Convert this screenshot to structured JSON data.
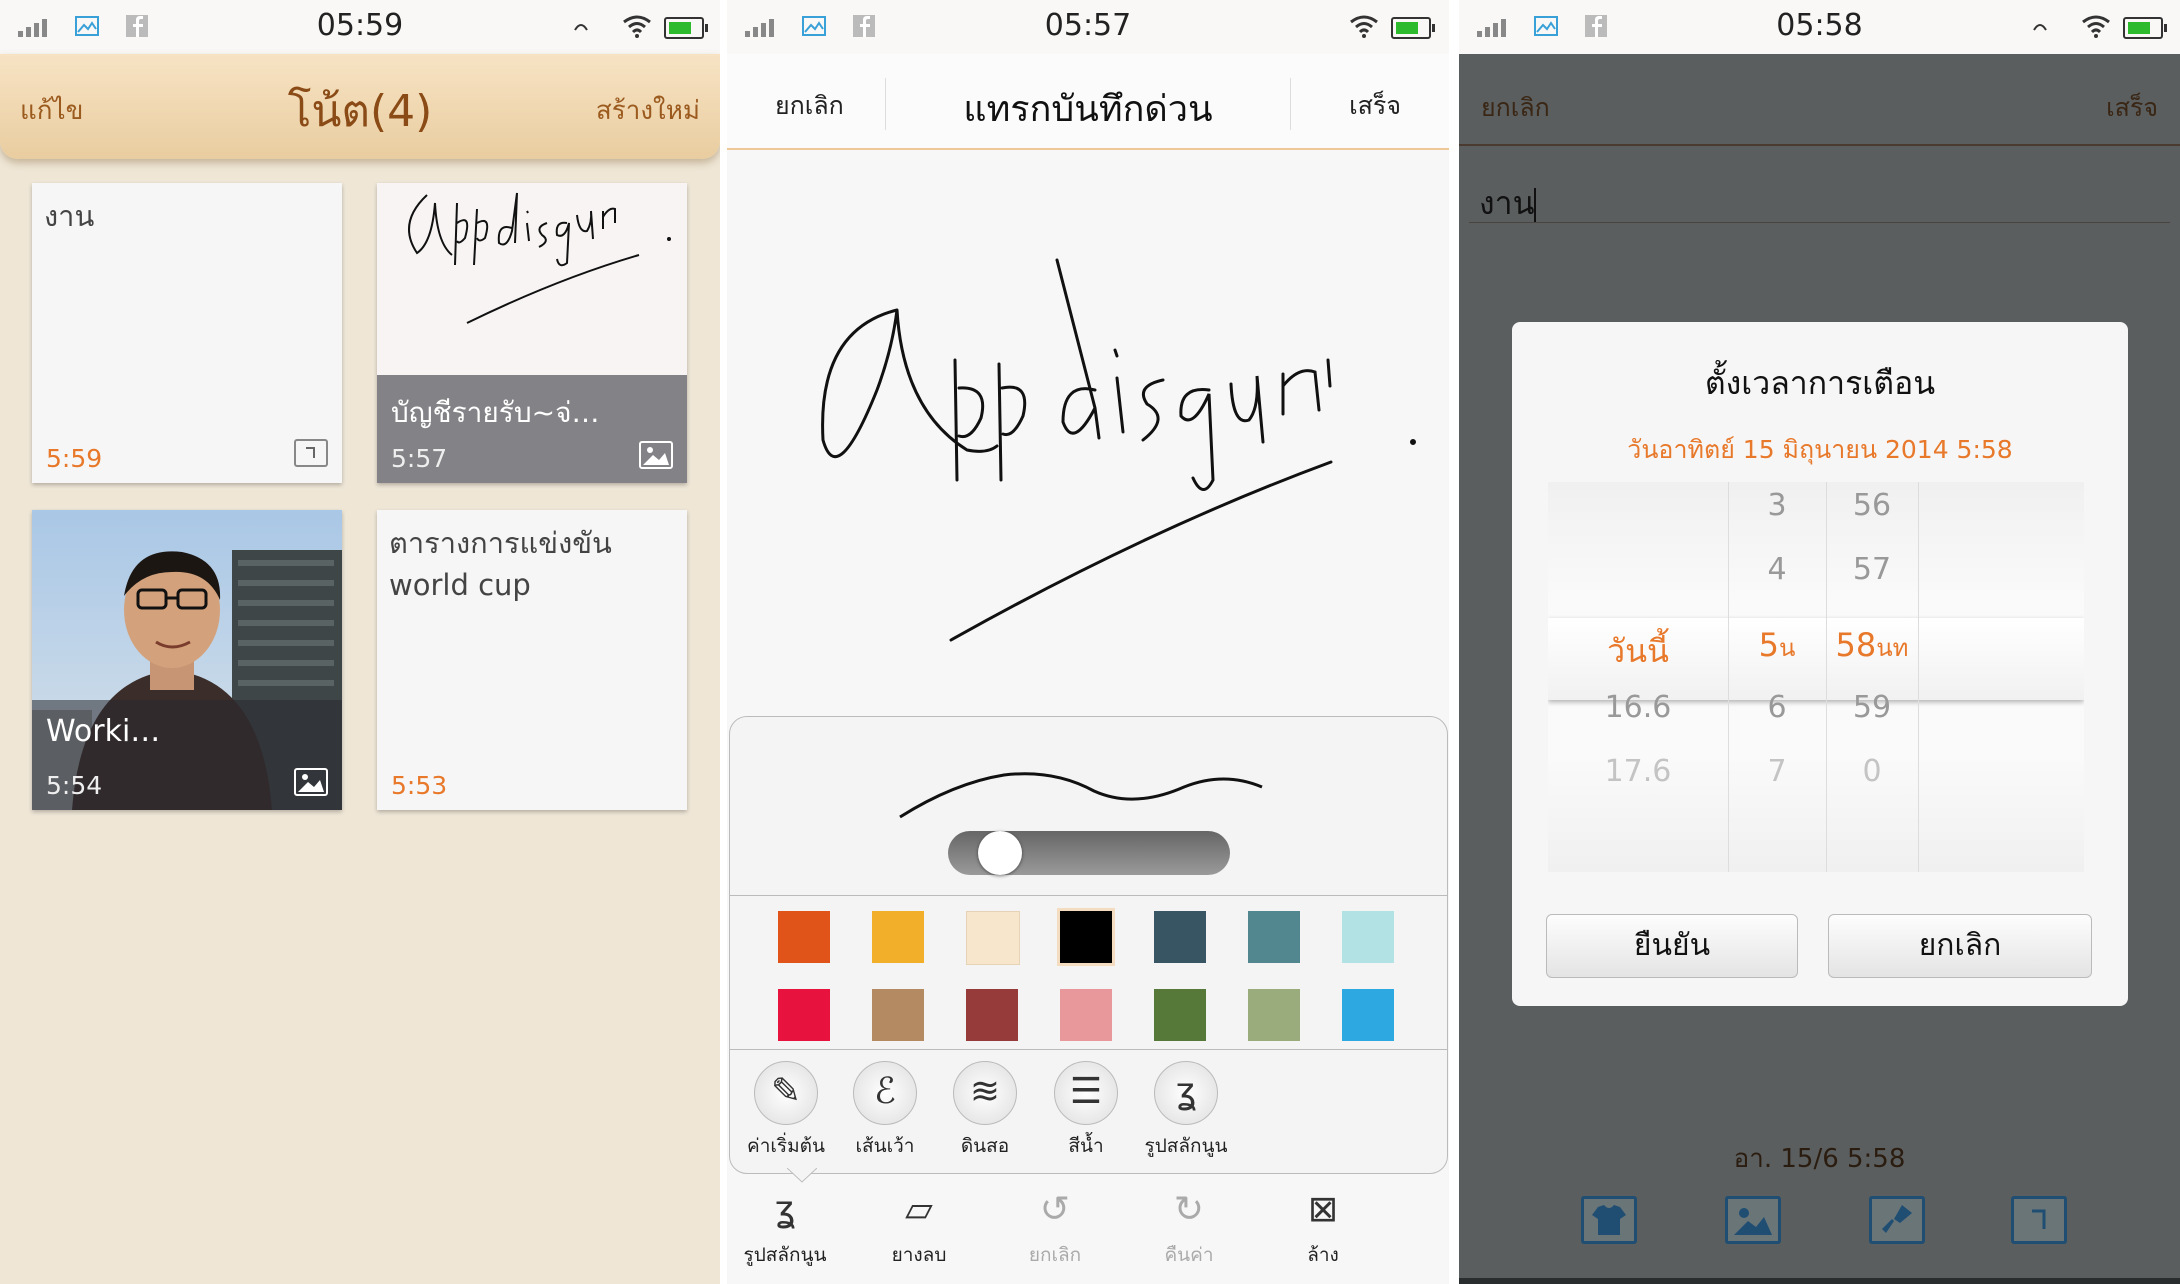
{
  "status_bars": [
    {
      "time": "05:59"
    },
    {
      "time": "05:57"
    },
    {
      "time": "05:58"
    }
  ],
  "notes_list": {
    "edit_label": "แก้ไข",
    "title": "โน้ต(4)",
    "new_label": "สร้างใหม่",
    "cards": [
      {
        "text": "งาน",
        "time": "5:59",
        "icon": "alarm-icon"
      },
      {
        "text": "บัญชีรายรับ~จ่…",
        "time": "5:57",
        "icon": "image-icon"
      },
      {
        "text": "Worki…",
        "time": "5:54",
        "icon": "image-icon"
      },
      {
        "line1": "ตารางการแข่งขัน",
        "line2": "world cup",
        "time": "5:53"
      }
    ]
  },
  "quick_note": {
    "cancel_label": "ยกเลิก",
    "title": "แทรกบันทึกด่วน",
    "done_label": "เสร็จ",
    "pen_panel": {
      "stroke_width_level": 0.08,
      "colors": [
        "#e0541a",
        "#f2b02a",
        "#f8e6cc",
        "#000000",
        "#385564",
        "#528790",
        "#b2e2e4",
        "#e8123e",
        "#b48a62",
        "#963a3a",
        "#e8989a",
        "#567839",
        "#9aab7c",
        "#2ea8e0"
      ],
      "selected_color": "#000000",
      "brushes": [
        {
          "label": "ค่าเริ่มต้น",
          "icon": "brush-icon"
        },
        {
          "label": "เส้นเว้า",
          "icon": "scribble-icon"
        },
        {
          "label": "ดินสอ",
          "icon": "pencil-scribble-icon"
        },
        {
          "label": "สีน้ำ",
          "icon": "watercolor-icon"
        },
        {
          "label": "รูปสลักนูน",
          "icon": "emboss-icon"
        }
      ]
    },
    "toolbar": [
      {
        "label": "รูปสลักนูน",
        "icon": "emboss-icon",
        "enabled": true
      },
      {
        "label": "ยางลบ",
        "icon": "eraser-icon",
        "enabled": true
      },
      {
        "label": "ยกเลิก",
        "icon": "undo-icon",
        "enabled": false
      },
      {
        "label": "คืนค่า",
        "icon": "redo-icon",
        "enabled": false
      },
      {
        "label": "ล้าง",
        "icon": "clear-icon",
        "enabled": true
      }
    ]
  },
  "reminder": {
    "cancel_label": "ยกเลิก",
    "done_label": "เสร็จ",
    "note_text": "งาน",
    "dialog": {
      "title": "ตั้งเวลาการเตือน",
      "date_line": "วันอาทิตย์  15 มิถุนายน 2014   5:58",
      "day_col": [
        "",
        "",
        "วันนี้",
        "16.6",
        "17.6"
      ],
      "hour_col": [
        "3",
        "4",
        "5",
        "6",
        "7"
      ],
      "minute_col": [
        "56",
        "57",
        "58",
        "59",
        "0"
      ],
      "hour_unit": "น",
      "minute_unit": "นท",
      "confirm_label": "ยืนยัน",
      "cancel_label": "ยกเลิก"
    },
    "footer_time": "อา. 15/6 5:58",
    "bottom_icons": [
      "shirt-icon",
      "image-icon",
      "brush-icon",
      "alarm-icon"
    ]
  }
}
